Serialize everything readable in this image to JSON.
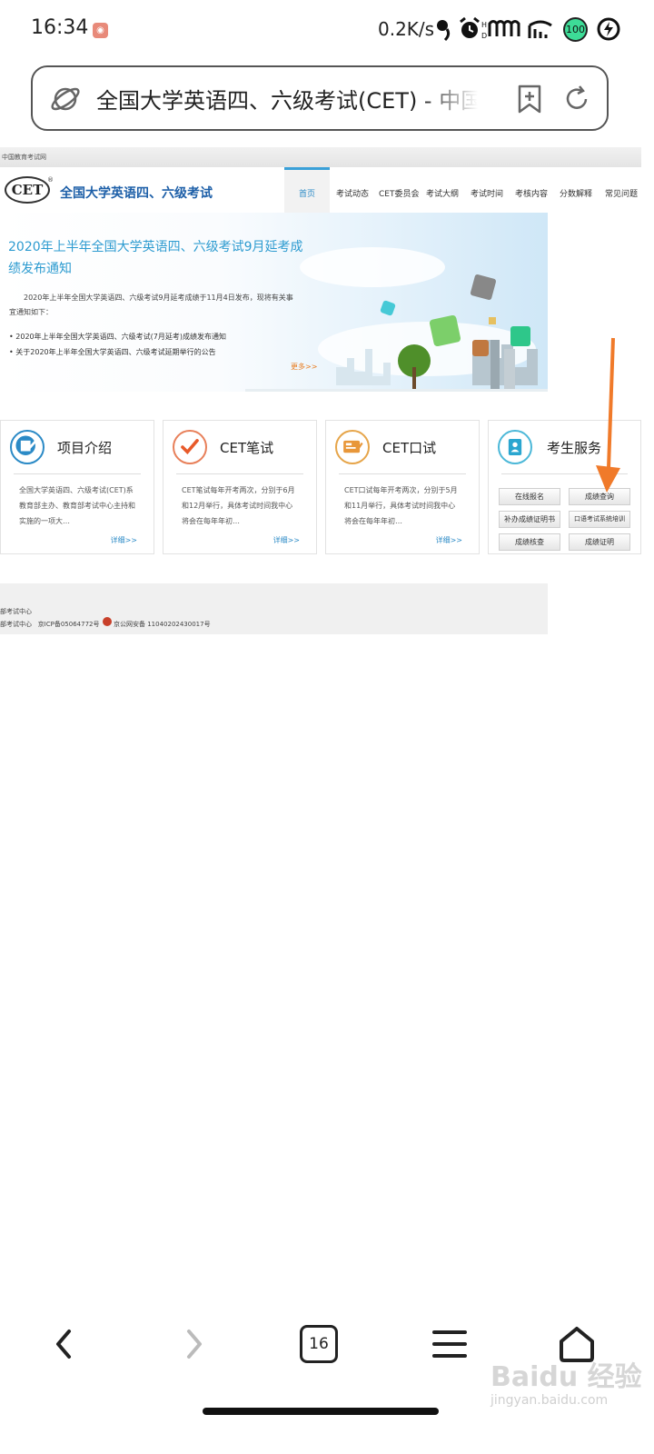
{
  "status_bar": {
    "time": "16:34",
    "net_speed": "0.2K/s",
    "battery": "100",
    "icons": [
      "app-badge-icon",
      "headset-icon",
      "alarm-icon",
      "hd-signal-icon",
      "wifi-icon",
      "battery-icon",
      "charging-icon"
    ]
  },
  "address_bar": {
    "url_title": "全国大学英语四、六级考试(CET) - 中国教育考试网"
  },
  "page": {
    "top_strip": "中国教育考试网",
    "logo_text": "CET",
    "logo_reg": "®",
    "site_name": "全国大学英语四、六级考试",
    "nav": [
      "首页",
      "考试动态",
      "CET委员会",
      "考试大纲",
      "考试时间",
      "考核内容",
      "分数解释",
      "常见问题"
    ],
    "banner": {
      "title": "2020年上半年全国大学英语四、六级考试9月延考成绩发布通知",
      "paragraph": "2020年上半年全国大学英语四、六级考试9月延考成绩于11月4日发布，现将有关事宜通知如下：",
      "list": [
        "2020年上半年全国大学英语四、六级考试(7月延考)成绩发布通知",
        "关于2020年上半年全国大学英语四、六级考试延期举行的公告"
      ],
      "more": "更多>>"
    },
    "cards": [
      {
        "title": "项目介绍",
        "body": "全国大学英语四、六级考试(CET)系教育部主办、教育部考试中心主持和实施的一项大…",
        "more": "详细>>"
      },
      {
        "title": "CET笔试",
        "body": "CET笔试每年开考两次，分别于6月和12月举行，具体考试时间我中心将会在每年年初…",
        "more": "详细>>"
      },
      {
        "title": "CET口试",
        "body": "CET口试每年开考两次，分别于5月和11月举行，具体考试时间我中心将会在每年年初…",
        "more": "详细>>"
      },
      {
        "title": "考生服务"
      }
    ],
    "services": [
      "在线报名",
      "成绩查询",
      "补办成绩证明书",
      "口语考试系统培训",
      "成绩核查",
      "成绩证明"
    ],
    "footer": {
      "line1": "部考试中心",
      "line2": "部考试中心   京ICP备05064772号",
      "line3": "京公网安备 11040202430017号"
    }
  },
  "bottom_nav": {
    "tab_count": "16",
    "icons": [
      "back-icon",
      "forward-icon",
      "tabs-icon",
      "menu-icon",
      "home-icon"
    ]
  },
  "watermark": {
    "brand": "Baidu 经验",
    "url": "jingyan.baidu.com"
  },
  "colors": {
    "accent_blue": "#2b8ac6",
    "arrow_orange": "#f07a2a",
    "battery_green": "#3ddc97"
  }
}
